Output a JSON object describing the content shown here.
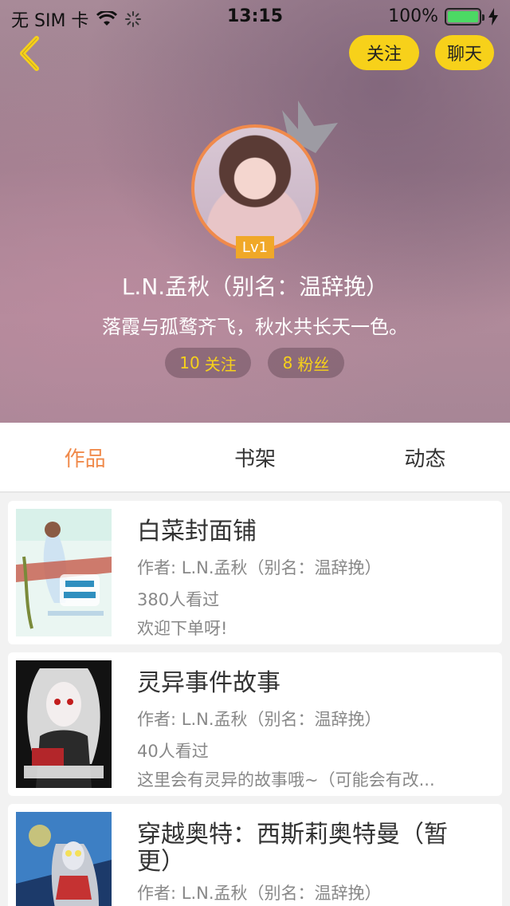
{
  "status_bar": {
    "carrier": "无 SIM 卡",
    "time": "13:15",
    "battery": "100%"
  },
  "header": {
    "follow_button": "关注",
    "chat_button": "聊天",
    "level": "Lv1",
    "name": "L.N.孟秋（别名：温辞挽）",
    "bio": "落霞与孤鹜齐飞，秋水共长天一色。",
    "follow_count": "10",
    "follow_label": "关注",
    "fans_count": "8",
    "fans_label": "粉丝"
  },
  "tabs": [
    "作品",
    "书架",
    "动态"
  ],
  "books": [
    {
      "title": "白菜封面铺",
      "author": "作者: L.N.孟秋（别名：温辞挽）",
      "views": "380人看过",
      "desc": "欢迎下单呀!"
    },
    {
      "title": "灵异事件故事",
      "author": "作者: L.N.孟秋（别名：温辞挽）",
      "views": "40人看过",
      "desc": "这里会有灵异的故事哦~（可能会有改..."
    },
    {
      "title": "穿越奥特：西斯莉奥特曼（暂更）",
      "author": "作者: L.N.孟秋（别名：温辞挽）",
      "views": "",
      "desc": ""
    }
  ],
  "colors": {
    "accent_yellow": "#f7d11a",
    "accent_orange": "#f08a4b"
  },
  "icons": {
    "back": "chevron-left-icon",
    "wifi": "wifi-icon",
    "battery": "battery-icon",
    "crown": "crown-icon"
  }
}
